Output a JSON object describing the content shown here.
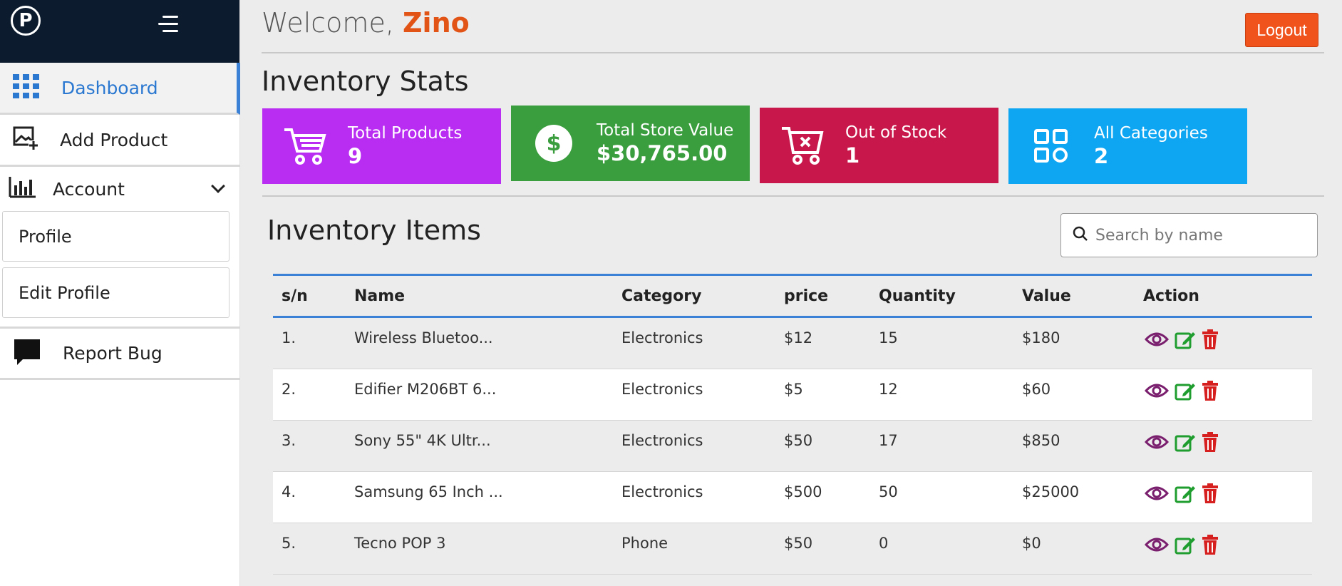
{
  "app": {
    "logo_letter": "P"
  },
  "sidebar": {
    "dashboard": "Dashboard",
    "add_product": "Add Product",
    "account": "Account",
    "profile": "Profile",
    "edit_profile": "Edit Profile",
    "report_bug": "Report Bug"
  },
  "header": {
    "welcome_prefix": "Welcome, ",
    "user_name": "Zino",
    "logout": "Logout"
  },
  "stats": {
    "title": "Inventory Stats",
    "cards": [
      {
        "label": "Total Products",
        "value": "9",
        "color": "#b92cf2",
        "icon": "cart-icon"
      },
      {
        "label": "Total Store Value",
        "value": "$30,765.00",
        "color": "#3a9d3e",
        "icon": "dollar-icon"
      },
      {
        "label": "Out of Stock",
        "value": "1",
        "color": "#c8174a",
        "icon": "cart-x-icon"
      },
      {
        "label": "All Categories",
        "value": "2",
        "color": "#0ea5f2",
        "icon": "categories-icon"
      }
    ]
  },
  "items": {
    "title": "Inventory Items",
    "search_placeholder": "Search by name",
    "columns": [
      "s/n",
      "Name",
      "Category",
      "price",
      "Quantity",
      "Value",
      "Action"
    ],
    "rows": [
      {
        "sn": "1.",
        "name": "Wireless Bluetoo...",
        "category": "Electronics",
        "price": "$12",
        "quantity": "15",
        "value": "$180"
      },
      {
        "sn": "2.",
        "name": "Edifier M206BT 6...",
        "category": "Electronics",
        "price": "$5",
        "quantity": "12",
        "value": "$60"
      },
      {
        "sn": "3.",
        "name": "Sony 55\" 4K Ultr...",
        "category": "Electronics",
        "price": "$50",
        "quantity": "17",
        "value": "$850"
      },
      {
        "sn": "4.",
        "name": "Samsung 65 Inch ...",
        "category": "Electronics",
        "price": "$500",
        "quantity": "50",
        "value": "$25000"
      },
      {
        "sn": "5.",
        "name": "Tecno POP 3",
        "category": "Phone",
        "price": "$50",
        "quantity": "0",
        "value": "$0"
      }
    ]
  },
  "colors": {
    "sidebar_header": "#0c1b2e",
    "accent_blue": "#3b82d6",
    "logout": "#f0531c",
    "view_icon": "#7a1f6e",
    "edit_icon": "#1f9d2e",
    "delete_icon": "#d62020"
  }
}
